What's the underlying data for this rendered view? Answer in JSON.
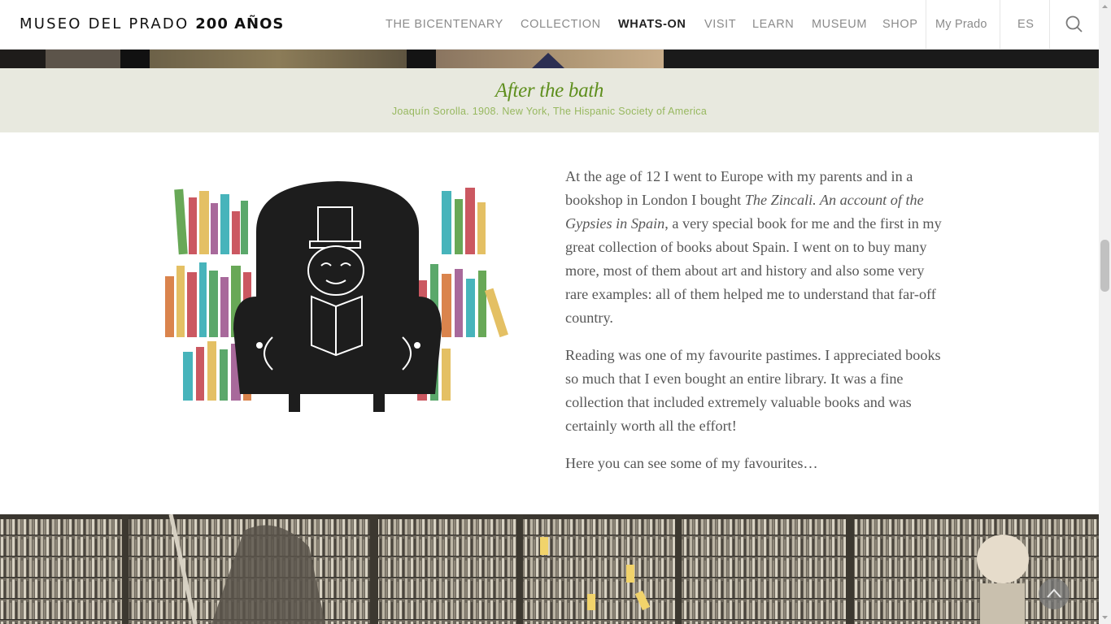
{
  "header": {
    "logo_text": "MUSEO DEL PRADO",
    "logo_bold": "200 AÑOS",
    "nav": [
      {
        "label": "THE BICENTENARY",
        "active": false
      },
      {
        "label": "COLLECTION",
        "active": false
      },
      {
        "label": "WHATS-ON",
        "active": true
      },
      {
        "label": "VISIT",
        "active": false
      },
      {
        "label": "LEARN",
        "active": false
      },
      {
        "label": "MUSEUM",
        "active": false
      },
      {
        "label": "SHOP",
        "active": false
      }
    ],
    "my_prado": "My Prado",
    "language": "ES",
    "search_icon": "search-icon"
  },
  "caption": {
    "title": "After the bath",
    "subtitle": "Joaquín Sorolla. 1908. New York, The Hispanic Society of America"
  },
  "article": {
    "p1_before": "At the age of 12 I went to Europe with my parents and in a bookshop in London I bought ",
    "p1_italic": "The Zincali. An account of the Gypsies in Spain",
    "p1_after": ", a very special book for me and the first in my great collection of books about Spain. I went on to buy many more, most of them about art and history and also some very rare examples: all of them helped me to understand that far-off country.",
    "p2": "Reading was one of my favourite pastimes. I appreciated books so much that I even bought an entire library. It was a fine collection that included extremely valuable books and was certainly worth all the effort!",
    "p3": "Here you can see some of my favourites…"
  },
  "controls": {
    "back_to_top_icon": "chevron-up-icon"
  },
  "colors": {
    "caption_bg": "#e8e9df",
    "caption_title": "#5f8f1e",
    "caption_subtitle": "#97b85f",
    "body_text": "#575757",
    "nav_active": "#222222",
    "nav_inactive": "#8b8b8b"
  }
}
